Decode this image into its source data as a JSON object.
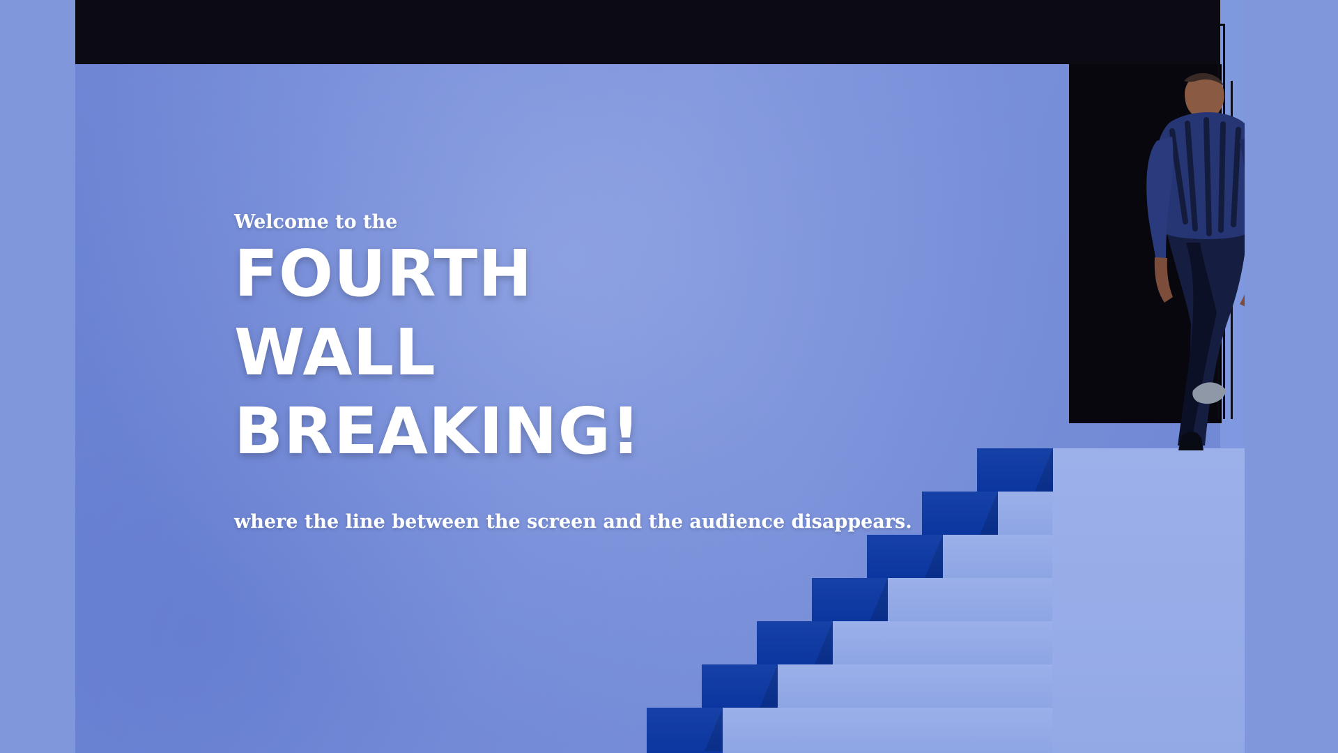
{
  "hero": {
    "eyebrow": "Welcome to the",
    "title_lines": [
      "FOURTH",
      "WALL",
      "BREAKING!"
    ],
    "subtitle": "where the line between the screen and the audience disappears."
  },
  "colors": {
    "outer_background": "#8197dc",
    "wall_blue": "#7189d6",
    "top_bar": "#0c0a12",
    "steps": "#0b369f",
    "landing": "#9cb0ea",
    "text": "#ffffff"
  },
  "illustration": {
    "icon": "staircase-doorway-figure-illustration"
  }
}
